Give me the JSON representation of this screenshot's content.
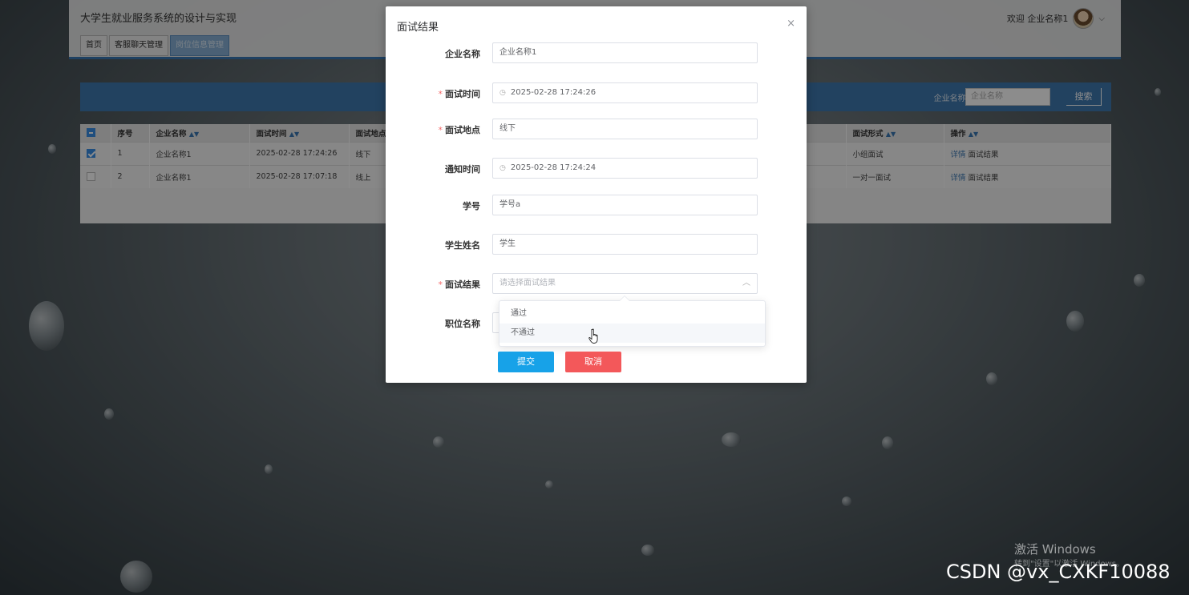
{
  "app": {
    "title": "大学生就业服务系统的设计与实现",
    "welcome": "欢迎 企业名称1",
    "tabs": [
      "首页",
      "客服聊天管理",
      "岗位信息管理"
    ],
    "search": {
      "label": "企业名称:",
      "placeholder": "企业名称",
      "button": "搜索"
    },
    "table": {
      "headers": [
        "序号",
        "企业名称",
        "面试时间",
        "面试地点",
        "面试形式",
        "操作"
      ],
      "rows": [
        {
          "index": "1",
          "company": "企业名称1",
          "time": "2025-02-28 17:24:26",
          "place": "线下",
          "form": "小组面试",
          "action_detail": "详情",
          "action_result": "面试结果"
        },
        {
          "index": "2",
          "company": "企业名称1",
          "time": "2025-02-28 17:07:18",
          "place": "线上",
          "form": "一对一面试",
          "action_detail": "详情",
          "action_result": "面试结果"
        }
      ]
    }
  },
  "dialog": {
    "title": "面试结果",
    "close": "×",
    "fields": {
      "company": {
        "label": "企业名称",
        "value": "企业名称1"
      },
      "interview_time": {
        "label": "面试时间",
        "value": "2025-02-28 17:24:26"
      },
      "interview_place": {
        "label": "面试地点",
        "value": "线下"
      },
      "notify_time": {
        "label": "通知时间",
        "value": "2025-02-28 17:24:24"
      },
      "student_id": {
        "label": "学号",
        "value": "学号a"
      },
      "student_name": {
        "label": "学生姓名",
        "value": "学生"
      },
      "result": {
        "label": "面试结果",
        "placeholder": "请选择面试结果"
      },
      "position": {
        "label": "职位名称"
      }
    },
    "required_mark": "*",
    "options": [
      "通过",
      "不通过"
    ],
    "submit": "提交",
    "cancel": "取消"
  },
  "watermark": {
    "activate": "激活 Windows",
    "activate_hint": "转到\"设置\"以激活 Windows。",
    "csdn": "CSDN @vx_CXKF10088"
  }
}
